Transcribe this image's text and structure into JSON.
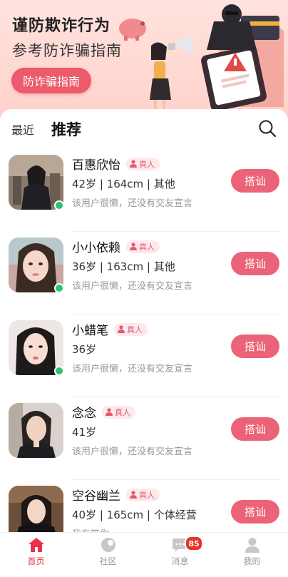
{
  "banner": {
    "title": "谨防欺诈行为",
    "subtitle": "参考防诈骗指南",
    "button_label": "防诈骗指南"
  },
  "tabs": {
    "recent": "最近",
    "recommend": "推荐"
  },
  "users": [
    {
      "name": "百惠欣怡",
      "verified": "真人",
      "info": "42岁 | 164cm | 其他",
      "bio": "该用户很懒，还没有交友宣言",
      "action": "搭讪",
      "online": true
    },
    {
      "name": "小小依赖",
      "verified": "真人",
      "info": "36岁 | 163cm | 其他",
      "bio": "该用户很懒，还没有交友宣言",
      "action": "搭讪",
      "online": true
    },
    {
      "name": "小蜡笔",
      "verified": "真人",
      "info": "36岁",
      "bio": "该用户很懒，还没有交友宣言",
      "action": "搭讪",
      "online": true
    },
    {
      "name": "念念",
      "verified": "真人",
      "info": "41岁",
      "bio": "该用户很懒，还没有交友宣言",
      "action": "搭讪",
      "online": false
    },
    {
      "name": "空谷幽兰",
      "verified": "真人",
      "info": "40岁 | 165cm | 个体经营",
      "bio": "我有笨你",
      "action": "搭讪",
      "online": false
    }
  ],
  "tabbar": {
    "home": "首页",
    "community": "社区",
    "messages": "消息",
    "messages_badge": "85",
    "mine": "我的"
  },
  "colors": {
    "accent": "#ec6377",
    "active_tab": "#e9334d",
    "online": "#2cc46b"
  }
}
